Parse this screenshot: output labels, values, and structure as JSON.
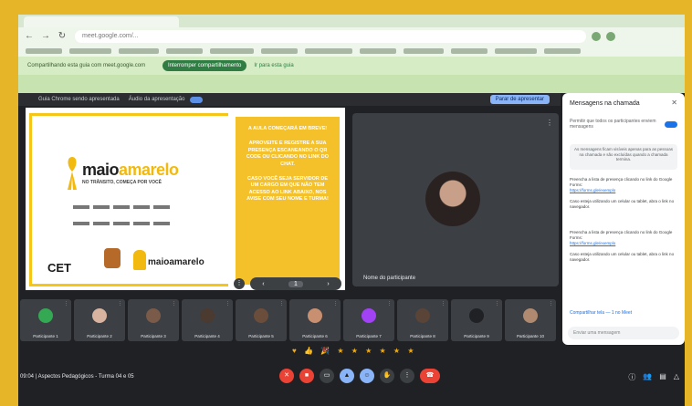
{
  "browser": {
    "url": "meet.google.com/...",
    "infobar": {
      "message": "Compartilhando esta guia com meet.google.com",
      "share_button": "Interromper compartilhamento",
      "secondary": "Ir para esta guia"
    }
  },
  "meet_toolbar": {
    "presenting_label": "Guia Chrome sendo apresentada",
    "audio_label": "Áudio da apresentação",
    "stop_button": "Parar de apresentar"
  },
  "slide": {
    "logo_prefix": "maio",
    "logo_suffix": "amarelo",
    "logo_tagline": "NO TRÂNSITO, COMEÇA POR VOCÊ",
    "footer_left": "CET",
    "footer_logo_prefix": "maio",
    "footer_logo_suffix": "amarelo",
    "box_paragraphs": [
      "A AULA COMEÇARÁ EM BREVE!",
      "APROVEITE E REGISTRE A SUA PRESENÇA ESCANEANDO O QR CODE OU CLICANDO NO LINK DO CHAT.",
      "CASO VOCÊ SEJA SERVIDOR DE UM CARGO EM QUE NÃO TEM ACESSO AO LINK ABAIXO, NOS AVISE COM SEU NOME E TURMA!"
    ],
    "page": "1",
    "prev": "‹",
    "next": "›"
  },
  "camera": {
    "name": "Nome do participante"
  },
  "chat": {
    "title": "Mensagens na chamada",
    "close": "✕",
    "setting_label": "Permitir que todos os participantes enviem mensagens",
    "note": "As mensagens ficam visíveis apenas para as pessoas na chamada e são excluídas quando a chamada termina.",
    "messages": [
      "Preencha a lista de presença clicando no link do Google Forms:",
      "https://forms.gle/exemplo",
      "Caso esteja utilizando um celular ou tablet, abra o link no navegador.",
      "Preencha a lista de presença clicando no link do Google Forms:",
      "https://forms.gle/exemplo",
      "Caso esteja utilizando um celular ou tablet, abra o link no navegador."
    ],
    "entry": "Compartilhar tela — 1 no Meet",
    "input_placeholder": "Enviar uma mensagem"
  },
  "filmstrip": [
    {
      "name": "Participante 1",
      "color": "#34a853"
    },
    {
      "name": "Participante 2",
      "color": "#d8b4a0"
    },
    {
      "name": "Participante 3",
      "color": "#7a5a48"
    },
    {
      "name": "Participante 4",
      "color": "#4a3a30"
    },
    {
      "name": "Participante 5",
      "color": "#6b4d3b"
    },
    {
      "name": "Participante 6",
      "color": "#c89070"
    },
    {
      "name": "Participante 7",
      "color": "#a142f4"
    },
    {
      "name": "Participante 8",
      "color": "#5a4438"
    },
    {
      "name": "Participante 9",
      "color": "#202124"
    },
    {
      "name": "Participante 10",
      "color": "#b08a70"
    }
  ],
  "reactions": "♥ 👍 🎉 ★ ★ ★ ★ ★ ★",
  "bottom": {
    "info": "09:04 | Aspectos Pedagógicos - Turma 04 e 05"
  }
}
